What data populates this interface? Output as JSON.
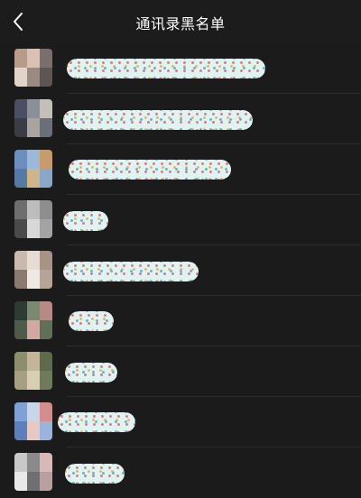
{
  "header": {
    "back_icon": "chevron-left-icon",
    "title": "通讯录黑名单"
  },
  "contacts": [
    {
      "name": "",
      "avatar_colors": [
        "#b89b8a",
        "#d8c2b3",
        "#7a6f6c",
        "#e2d4c8",
        "#9b8a80",
        "#5c5553"
      ]
    },
    {
      "name": "",
      "avatar_colors": [
        "#4a4f63",
        "#8b8f98",
        "#c4bfb8",
        "#3b3c44",
        "#a8a49f",
        "#6c6f7a"
      ]
    },
    {
      "name": "",
      "avatar_colors": [
        "#6d8fbf",
        "#9cb8d8",
        "#c59d6c",
        "#5878a6",
        "#d2b48a",
        "#8aa6c9"
      ]
    },
    {
      "name": "",
      "avatar_colors": [
        "#6e6e6e",
        "#bdbdbd",
        "#8e8e8e",
        "#4a4a4a",
        "#d8d8d8",
        "#a3a3a3"
      ]
    },
    {
      "name": "",
      "avatar_colors": [
        "#c9b9ae",
        "#e7dcd4",
        "#a89387",
        "#8a7a70",
        "#f0e8e2",
        "#b7a498"
      ]
    },
    {
      "name": "",
      "avatar_colors": [
        "#2e3a34",
        "#7b8a6e",
        "#b88a86",
        "#4d5c4a",
        "#d2a8a2",
        "#5f6f58"
      ]
    },
    {
      "name": "",
      "avatar_colors": [
        "#8b8f6d",
        "#c4b59a",
        "#5e6a4c",
        "#a79f84",
        "#d9cdb2",
        "#6f7a5a"
      ]
    },
    {
      "name": "",
      "avatar_colors": [
        "#7fa1d6",
        "#c9d6ea",
        "#d48d8d",
        "#5e7fb8",
        "#e8c8c2",
        "#9cb4dc"
      ]
    },
    {
      "name": "",
      "avatar_colors": [
        "#c9c9c9",
        "#8a8a8a",
        "#d9b8b8",
        "#e9e9e9",
        "#6f6f6f",
        "#b8a0a0"
      ]
    }
  ]
}
